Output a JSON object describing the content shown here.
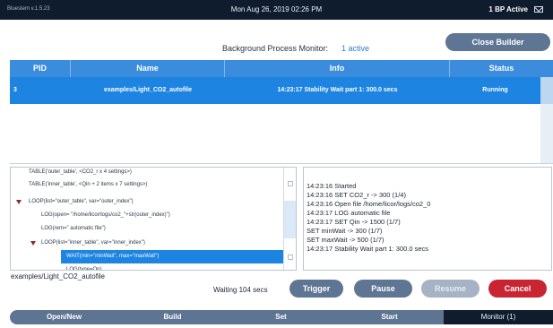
{
  "status_bar": {
    "version": "Bluestem v.1.5.23",
    "datetime": "Mon Aug 26, 2019 02:26 PM",
    "bp_status": "1 BP Active"
  },
  "monitor": {
    "label": "Background Process Monitor:",
    "active_count": "1 active",
    "close_button": "Close Builder"
  },
  "process_table": {
    "columns": [
      "PID",
      "Name",
      "Info",
      "Status"
    ],
    "rows": [
      {
        "pid": "3",
        "name": "examples/Light_CO2_autofile",
        "info": "14:23:17 Stability Wait part 1: 300.0 secs",
        "status": "Running"
      }
    ]
  },
  "script_lines": [
    "TABLE('outer_table', <CO2_r x 4 settings>)",
    "TABLE('inner_table', <Qin + 2 items x 7 settings>)",
    "LOOP(list=\"outer_table\", var=\"outer_index\")",
    "LOG(open= \"/home/licor/logs/co2_\"+str(outer_index)\")",
    "LOG(rem=\" automatic file\")",
    "LOOP(list=\"inner_table\", var=\"inner_index\")",
    "WAIT(min=\"minWait\", max=\"maxWait\")",
    "LOG(type=On)"
  ],
  "log_lines": [
    "14:23:16 Started",
    "14:23:16 SET CO2_r -> 300 (1/4)",
    "14:23:16 Open file /home/licor/logs/co2_0",
    "14:23:17 LOG automatic file",
    "14:23:17 SET Qin -> 1500 (1/7)",
    "SET minWait -> 300 (1/7)",
    "SET maxWait -> 500 (1/7)",
    "14:23:17 Stability Wait part 1: 300.0 secs"
  ],
  "current_file": "examples/Light_CO2_autofile",
  "waiting_text": "Waiting 104 secs",
  "actions": {
    "trigger": "Trigger",
    "pause": "Pause",
    "resume": "Resume",
    "cancel": "Cancel"
  },
  "nav": {
    "open_new": "Open/New",
    "build": "Build",
    "set": "Set",
    "start": "Start",
    "monitor": "Monitor (1)"
  },
  "colors": {
    "accent": "#3b8cdc",
    "selection": "#1d84e2",
    "button": "#5e7694",
    "cancel": "#c92432",
    "top_bar": "#0f1c2e"
  }
}
